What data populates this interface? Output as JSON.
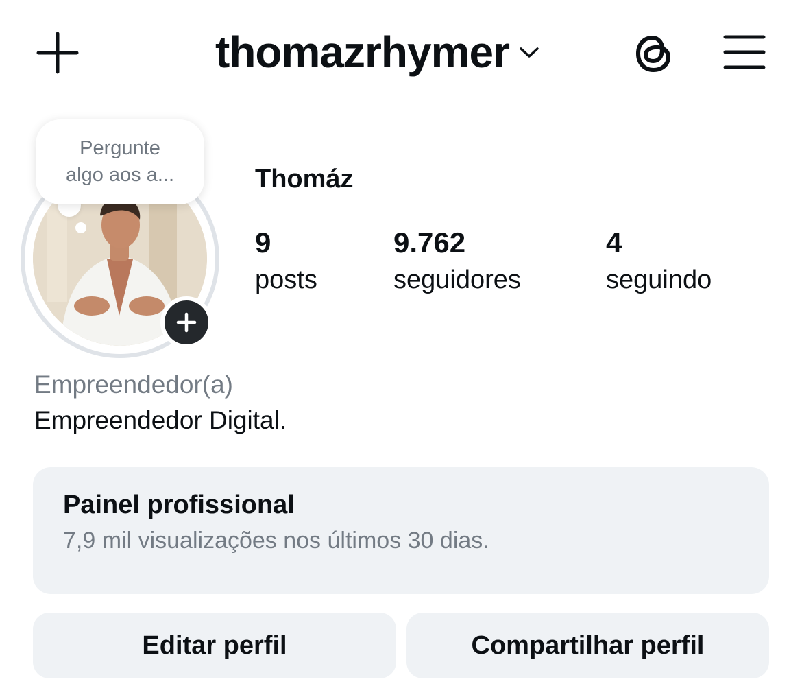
{
  "header": {
    "username": "thomazrhymer",
    "icons": {
      "create": "plus-icon",
      "switch_account": "chevron-down-icon",
      "threads": "threads-icon",
      "menu": "hamburger-menu-icon"
    }
  },
  "profile": {
    "note": "Pergunte\nalgo aos a...",
    "display_name": "Thomáz",
    "stats": [
      {
        "value": "9",
        "label": "posts"
      },
      {
        "value": "9.762",
        "label": "seguidores"
      },
      {
        "value": "4",
        "label": "seguindo"
      }
    ],
    "category": "Empreendedor(a)",
    "bio": "Empreendedor Digital."
  },
  "dashboard": {
    "title": "Painel profissional",
    "subtitle": "7,9 mil visualizações nos últimos 30 dias."
  },
  "actions": {
    "edit": "Editar perfil",
    "share": "Compartilhar perfil"
  },
  "colors": {
    "text": "#0c1014",
    "secondary_text": "#737b84",
    "surface": "#eff2f5",
    "story_ring": "#dfe3e8",
    "add_badge": "#24282c"
  }
}
